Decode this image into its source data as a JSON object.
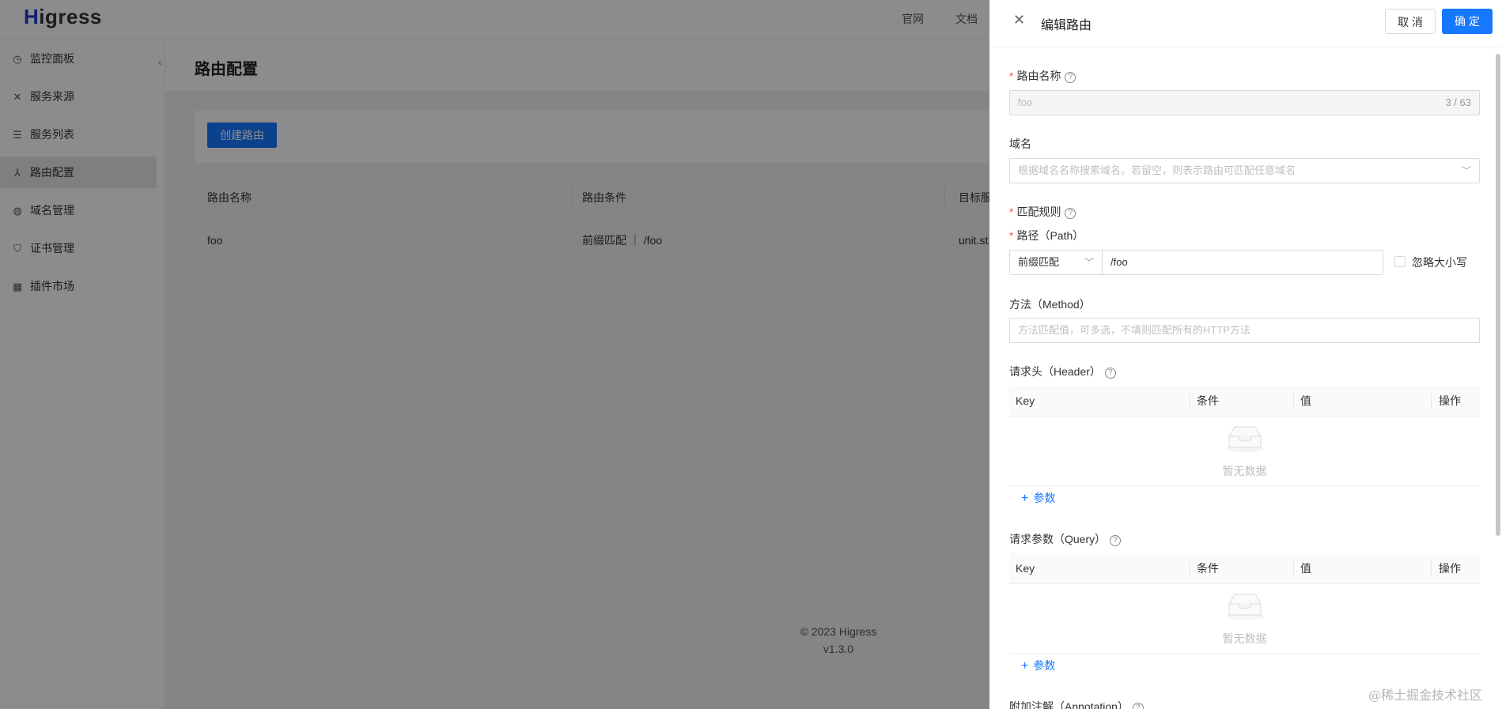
{
  "app": {
    "logo": {
      "first": "H",
      "rest": "igress"
    },
    "topnav": [
      "官网",
      "文档"
    ],
    "sidebar": [
      {
        "label": "监控面板",
        "icon": "dashboard-icon"
      },
      {
        "label": "服务来源",
        "icon": "source-icon"
      },
      {
        "label": "服务列表",
        "icon": "list-icon"
      },
      {
        "label": "路由配置",
        "icon": "route-icon"
      },
      {
        "label": "域名管理",
        "icon": "globe-icon"
      },
      {
        "label": "证书管理",
        "icon": "shield-icon"
      },
      {
        "label": "插件市场",
        "icon": "plugin-icon"
      }
    ],
    "page_title": "路由配置",
    "create_button": "创建路由",
    "table": {
      "headers": [
        "路由名称",
        "路由条件",
        "目标服"
      ],
      "rows": [
        {
          "name": "foo",
          "condition": "前缀匹配 ｜ /foo",
          "target": "unit.st"
        }
      ]
    },
    "footer": {
      "copyright": "© 2023 Higress",
      "version": "v1.3.0"
    }
  },
  "drawer": {
    "title": "编辑路由",
    "cancel_label": "取 消",
    "ok_label": "确 定",
    "route_name": {
      "label": "路由名称",
      "value": "foo",
      "count": "3 / 63"
    },
    "domain": {
      "label": "域名",
      "placeholder": "根据域名名称搜索域名。若留空，则表示路由可匹配任意域名"
    },
    "match_rule": {
      "label": "匹配规则"
    },
    "path": {
      "label": "路径（Path）",
      "match_type": "前缀匹配",
      "value": "/foo",
      "ignore_case_label": "忽略大小写"
    },
    "method": {
      "label": "方法（Method）",
      "placeholder": "方法匹配值，可多选，不填则匹配所有的HTTP方法"
    },
    "header": {
      "label": "请求头（Header）",
      "columns": [
        "Key",
        "条件",
        "值",
        "操作"
      ],
      "empty_text": "暂无数据",
      "add_label": "参数"
    },
    "query": {
      "label": "请求参数（Query）",
      "columns": [
        "Key",
        "条件",
        "值",
        "操作"
      ],
      "empty_text": "暂无数据",
      "add_label": "参数"
    },
    "annotation": {
      "label": "附加注解（Annotation）"
    }
  },
  "watermark": "@稀土掘金技术社区",
  "colors": {
    "primary": "#1677ff",
    "required": "#ff4d4f",
    "mask": "rgba(0,0,0,0.45)"
  }
}
